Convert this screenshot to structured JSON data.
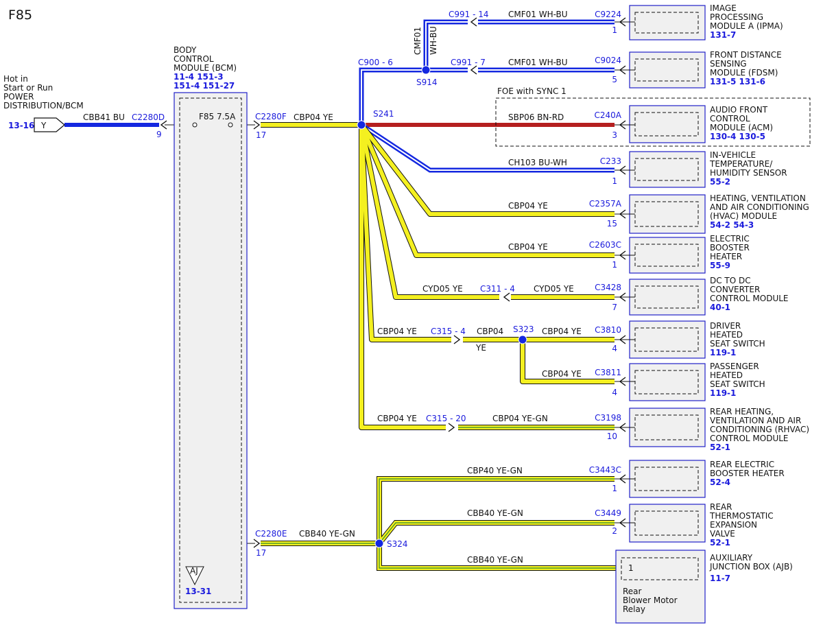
{
  "diagram_title": "F85",
  "power_source": {
    "lines": [
      "Hot in",
      "Start or Run",
      "POWER",
      "DISTRIBUTION/BCM"
    ],
    "ref": "13-16",
    "flag": "Y",
    "wire": "CBB41  BU",
    "connector": "C2280D",
    "pin": "9"
  },
  "bcm": {
    "lines": [
      "BODY",
      "CONTROL",
      "MODULE (BCM)"
    ],
    "refs": [
      "11-4  151-3",
      "151-4  151-27"
    ],
    "fuse": "F85  7.5A",
    "ground_flag": "AJ",
    "ground_ref": "13-31"
  },
  "splices": {
    "s241": "S241",
    "s914": "S914",
    "s323": "S323",
    "s324": "S324"
  },
  "wires": {
    "c2280f": {
      "connector": "C2280F",
      "pin": "17",
      "wire": "CBP04  YE"
    },
    "c2280e": {
      "connector": "C2280E",
      "pin": "17",
      "wire": "CBB40  YE-GN"
    },
    "c900": "C900 - 6",
    "cmf01_vert": [
      "CMF01",
      "WH-BU"
    ],
    "c991_14": "C991 - 14",
    "c991_7": "C991 - 7",
    "cmf01_a": "CMF01  WH-BU",
    "cmf01_b": "CMF01  WH-BU",
    "sbp06": "SBP06  BN-RD",
    "ch103": "CH103  BU-WH",
    "cbp04_hvac": "CBP04  YE",
    "cbp04_heater": "CBP04  YE",
    "cyd05_a": "CYD05  YE",
    "c311": "C311 - 4",
    "cyd05_b": "CYD05  YE",
    "cbp04_driver_a": "CBP04  YE",
    "c315_4": "C315 - 4",
    "cbp04_driver_b": "CBP04",
    "ye": "YE",
    "cbp04_driver_c": "CBP04  YE",
    "cbp04_pass": "CBP04  YE",
    "cbp04_rear": "CBP04  YE",
    "c315_20": "C315 - 20",
    "cbp04_rear_b": "CBP04  YE-GN",
    "cbp40": "CBP40  YE-GN",
    "cbb40_a": "CBB40  YE-GN",
    "cbb40_b": "CBB40  YE-GN"
  },
  "foe_label": "FOE with SYNC 1",
  "modules": [
    {
      "id": "ipma",
      "connector": "C9224",
      "pin": "1",
      "lines": [
        "IMAGE",
        "PROCESSING",
        "MODULE A (IPMA)"
      ],
      "ref": "131-7"
    },
    {
      "id": "fdsm",
      "connector": "C9024",
      "pin": "5",
      "lines": [
        "FRONT DISTANCE",
        "SENSING",
        "MODULE (FDSM)"
      ],
      "ref": "131-5 131-6"
    },
    {
      "id": "acm",
      "connector": "C240A",
      "pin": "3",
      "lines": [
        "AUDIO FRONT",
        "CONTROL",
        "MODULE (ACM)"
      ],
      "ref": "130-4 130-5"
    },
    {
      "id": "ivts",
      "connector": "C233",
      "pin": "1",
      "lines": [
        "IN-VEHICLE",
        "TEMPERATURE/",
        "HUMIDITY SENSOR"
      ],
      "ref": "55-2"
    },
    {
      "id": "hvac",
      "connector": "C2357A",
      "pin": "15",
      "lines": [
        "HEATING, VENTILATION",
        "AND AIR CONDITIONING",
        "(HVAC) MODULE"
      ],
      "ref": "54-2  54-3"
    },
    {
      "id": "ebh",
      "connector": "C2603C",
      "pin": "1",
      "lines": [
        "ELECTRIC",
        "BOOSTER",
        "HEATER"
      ],
      "ref": "55-9"
    },
    {
      "id": "dcdc",
      "connector": "C3428",
      "pin": "7",
      "lines": [
        "DC TO DC",
        "CONVERTER",
        "CONTROL MODULE"
      ],
      "ref": "40-1"
    },
    {
      "id": "dhss",
      "connector": "C3810",
      "pin": "4",
      "lines": [
        "DRIVER",
        "HEATED",
        "SEAT SWITCH"
      ],
      "ref": "119-1"
    },
    {
      "id": "phss",
      "connector": "C3811",
      "pin": "4",
      "lines": [
        "PASSENGER",
        "HEATED",
        "SEAT SWITCH"
      ],
      "ref": "119-1"
    },
    {
      "id": "rhvac",
      "connector": "C3198",
      "pin": "10",
      "lines": [
        "REAR HEATING,",
        "VENTILATION AND AIR",
        "CONDITIONING (RHVAC)",
        "CONTROL MODULE"
      ],
      "ref": "52-1"
    },
    {
      "id": "rebh",
      "connector": "C3443C",
      "pin": "1",
      "lines": [
        "REAR ELECTRIC",
        "BOOSTER HEATER"
      ],
      "ref": "52-4"
    },
    {
      "id": "rtev",
      "connector": "C3449",
      "pin": "2",
      "lines": [
        "REAR",
        "THERMOSTATIC",
        "EXPANSION",
        "VALVE"
      ],
      "ref": "52-1"
    },
    {
      "id": "ajb",
      "pin": "1",
      "lines": [
        "AUXILIARY",
        "JUNCTION BOX (AJB)"
      ],
      "ref": "11-7",
      "inner_lines": [
        "Rear",
        "Blower Motor",
        "Relay"
      ]
    }
  ]
}
